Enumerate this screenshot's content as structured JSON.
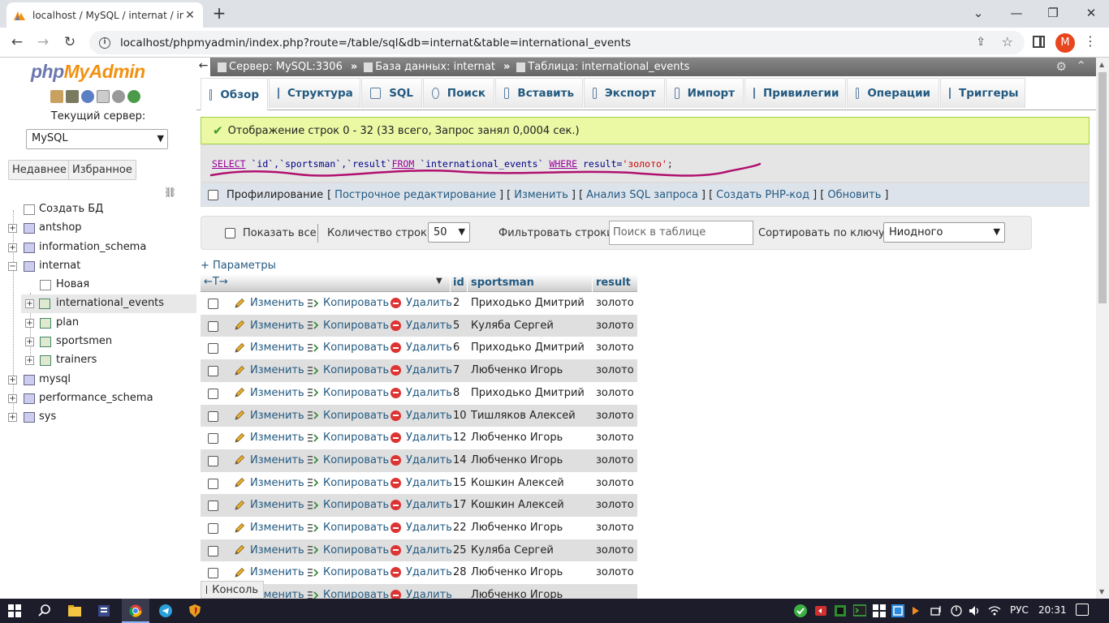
{
  "browser": {
    "tab_title": "localhost / MySQL / internat / int",
    "url": "localhost/phpmyadmin/index.php?route=/table/sql&db=internat&table=international_events",
    "profile_initial": "M"
  },
  "sidebar": {
    "logo_php": "php",
    "logo_myadmin": "MyAdmin",
    "server_label": "Текущий сервер:",
    "server_value": "MySQL",
    "recent_label": "Недавнее",
    "favorites_label": "Избранное",
    "create_db": "Создать БД",
    "databases": [
      {
        "name": "antshop"
      },
      {
        "name": "information_schema"
      },
      {
        "name": "internat"
      },
      {
        "name": "mysql"
      },
      {
        "name": "performance_schema"
      },
      {
        "name": "sys"
      }
    ],
    "internat_children": [
      {
        "name": "Новая"
      },
      {
        "name": "international_events"
      },
      {
        "name": "plan"
      },
      {
        "name": "sportsmen"
      },
      {
        "name": "trainers"
      }
    ]
  },
  "breadcrumb": {
    "server": "Сервер: MySQL:3306",
    "database": "База данных: internat",
    "table": "Таблица: international_events",
    "sep": "»"
  },
  "tabs": [
    {
      "label": "Обзор"
    },
    {
      "label": "Структура"
    },
    {
      "label": "SQL"
    },
    {
      "label": "Поиск"
    },
    {
      "label": "Вставить"
    },
    {
      "label": "Экспорт"
    },
    {
      "label": "Импорт"
    },
    {
      "label": "Привилегии"
    },
    {
      "label": "Операции"
    },
    {
      "label": "Триггеры"
    }
  ],
  "success_message": "Отображение строк 0 - 32 (33 всего, Запрос занял 0,0004 сек.)",
  "sql": {
    "kw_select": "SELECT",
    "part1": " `id`,`sportsman`,`result`",
    "kw_from": "FROM",
    "part2": " `international_events` ",
    "kw_where": "WHERE",
    "part3": " result=",
    "str": "'золото'",
    "part4": ";"
  },
  "profiling": {
    "label": "Профилирование",
    "links": [
      "Построчное редактирование",
      "Изменить",
      "Анализ SQL запроса",
      "Создать PHP-код",
      "Обновить"
    ]
  },
  "nav": {
    "show_all": "Показать все",
    "rows_count_label": "Количество строк:",
    "rows_count_value": "50",
    "filter_label": "Фильтровать строки:",
    "filter_placeholder": "Поиск в таблице",
    "sort_label": "Сортировать по ключу:",
    "sort_value": "Ниодного"
  },
  "params_link": "+ Параметры",
  "table": {
    "columns": [
      "id",
      "sportsman",
      "result"
    ],
    "action_edit": "Изменить",
    "action_copy": "Копировать",
    "action_delete": "Удалить",
    "rows": [
      {
        "id": "2",
        "sportsman": "Приходько Дмитрий",
        "result": "золото"
      },
      {
        "id": "5",
        "sportsman": "Куляба Сергей",
        "result": "золото"
      },
      {
        "id": "6",
        "sportsman": "Приходько Дмитрий",
        "result": "золото"
      },
      {
        "id": "7",
        "sportsman": "Любченко Игорь",
        "result": "золото"
      },
      {
        "id": "8",
        "sportsman": "Приходько Дмитрий",
        "result": "золото"
      },
      {
        "id": "10",
        "sportsman": "Тишляков Алексей",
        "result": "золото"
      },
      {
        "id": "12",
        "sportsman": "Любченко Игорь",
        "result": "золото"
      },
      {
        "id": "14",
        "sportsman": "Любченко Игорь",
        "result": "золото"
      },
      {
        "id": "15",
        "sportsman": "Кошкин Алексей",
        "result": "золото"
      },
      {
        "id": "17",
        "sportsman": "Кошкин Алексей",
        "result": "золото"
      },
      {
        "id": "22",
        "sportsman": "Любченко Игорь",
        "result": "золото"
      },
      {
        "id": "25",
        "sportsman": "Куляба Сергей",
        "result": "золото"
      },
      {
        "id": "28",
        "sportsman": "Любченко Игорь",
        "result": "золото"
      },
      {
        "id": "",
        "sportsman": "Любченко Игорь",
        "result": ""
      }
    ]
  },
  "console_label": "Консоль",
  "taskbar": {
    "lang": "РУС",
    "time": "20:31"
  },
  "colors": {
    "link": "#235a81",
    "success_bg": "#ebf8a4",
    "annotation": "#b0106e"
  }
}
